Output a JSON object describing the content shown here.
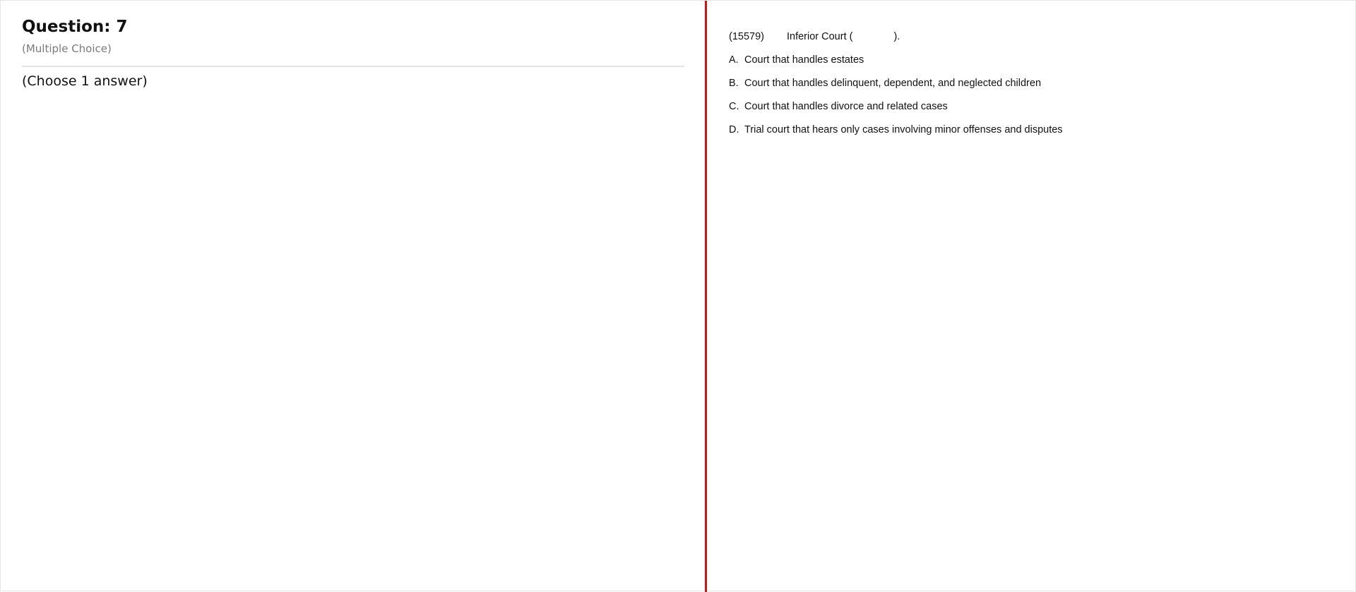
{
  "question": {
    "title": "Question: 7",
    "type": "(Multiple Choice)",
    "instruction": "(Choose 1 answer)"
  },
  "stem": {
    "id": "(15579)",
    "text": "Inferior Court (",
    "closing": ")."
  },
  "options": [
    {
      "letter": "A.",
      "text": "Court that handles estates"
    },
    {
      "letter": "B.",
      "text": "Court that handles delinquent, dependent, and neglected children"
    },
    {
      "letter": "C.",
      "text": "Court that handles divorce and related cases"
    },
    {
      "letter": "D.",
      "text": "Trial court that hears only cases involving minor offenses and disputes"
    }
  ],
  "colors": {
    "divider": "#c8161d",
    "subtitle": "#7a7a7a"
  }
}
